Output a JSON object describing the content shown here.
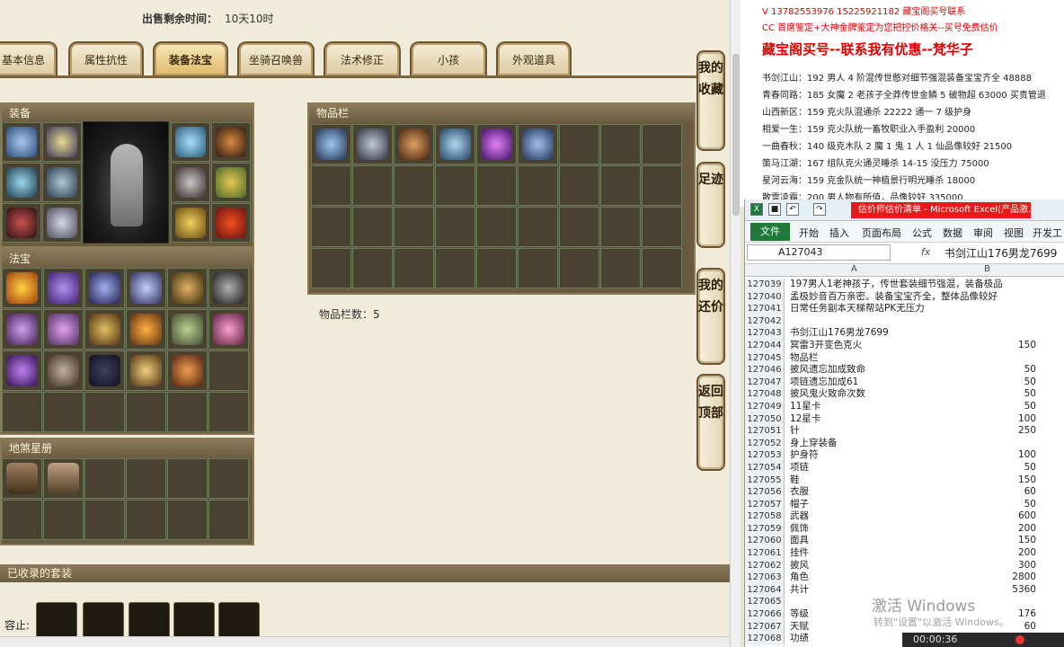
{
  "sale": {
    "label": "出售剩余时间：",
    "value": "10天10时"
  },
  "tabs": [
    "基本信息",
    "属性抗性",
    "装备法宝",
    "坐骑召唤兽",
    "法术修正",
    "小孩",
    "外观道具"
  ],
  "panels": {
    "equip": "装备",
    "fabao": "法宝",
    "star": "地煞星册",
    "items": "物品栏"
  },
  "item_count": "物品栏数：5",
  "sets_title": "已收录的套装",
  "sets_label": "容止:",
  "side_buttons": [
    "我的收藏",
    "足迹",
    "我的还价",
    "返回顶部"
  ],
  "doc": {
    "line1": "V 13782553976    15225921182   藏宝阁买号联系",
    "line2": "CC 首席鉴定+大神金牌鉴定为您把控价格关--买号免费估价",
    "line3": "藏宝阁买号--联系我有优惠--梵华子",
    "list": [
      "书剑江山：192 男人 4 阶混传世憨对细节强混装备宝宝齐全 48888",
      "青春同路：185 女魔 2 老孩子全莽传世金鳞 5 破物超 63000 买贵管退",
      "山西新区：159 克火队混通杀 22222 通一 7 级护身",
      "相爱一生：159 克火队统一畜牧职业入手盈利 20000",
      "一曲春秋：140 级克木队 2 魔 1 鬼 1 人 1 仙品像较好 21500",
      "策马江湖：167 组队克火通灵睡杀 14-15 没压力 75000",
      "星河云海：159 克金队统一神植景行明光睡杀 18000",
      "散雪凌霜：200 男人物有所值，品像较好 335000"
    ]
  },
  "excel": {
    "title": "估价师估价清单 - Microsoft Excel(产品激...",
    "ribbon": [
      "文件",
      "开始",
      "插入",
      "页面布局",
      "公式",
      "数据",
      "审阅",
      "视图",
      "开发工"
    ],
    "namebox": "A127043",
    "fx": "fx",
    "formula": "书剑江山176男龙7699",
    "col_a": "A",
    "col_b": "B",
    "rows": [
      {
        "n": "127039",
        "a": "197男人1老神孩子，传世套装细节强混，装备极品",
        "b": ""
      },
      {
        "n": "127040",
        "a": "孟极妙音百万亲密。装备宝宝齐全，整体品像较好",
        "b": ""
      },
      {
        "n": "127041",
        "a": "日常任务副本天梯帮站PK无压力",
        "b": ""
      },
      {
        "n": "127042",
        "a": "",
        "b": ""
      },
      {
        "n": "127043",
        "a": "书剑江山176男龙7699",
        "b": ""
      },
      {
        "n": "127044",
        "a": "冥雷3开变色克火",
        "b": "150"
      },
      {
        "n": "127045",
        "a": "物品栏",
        "b": ""
      },
      {
        "n": "127046",
        "a": "披风遗忘加成致命",
        "b": "50"
      },
      {
        "n": "127047",
        "a": "项链遗忘加成61",
        "b": "50"
      },
      {
        "n": "127048",
        "a": "披风鬼火致命次数",
        "b": "50"
      },
      {
        "n": "127049",
        "a": "11星卡",
        "b": "50"
      },
      {
        "n": "127050",
        "a": "12星卡",
        "b": "100"
      },
      {
        "n": "127051",
        "a": "针",
        "b": "250"
      },
      {
        "n": "127052",
        "a": "身上穿装备",
        "b": ""
      },
      {
        "n": "127053",
        "a": "护身符",
        "b": "100"
      },
      {
        "n": "127054",
        "a": "项链",
        "b": "50"
      },
      {
        "n": "127055",
        "a": "鞋",
        "b": "150"
      },
      {
        "n": "127056",
        "a": "衣服",
        "b": "60"
      },
      {
        "n": "127057",
        "a": "帽子",
        "b": "50"
      },
      {
        "n": "127058",
        "a": "武器",
        "b": "600"
      },
      {
        "n": "127059",
        "a": "佩饰",
        "b": "200"
      },
      {
        "n": "127060",
        "a": "面具",
        "b": "150"
      },
      {
        "n": "127061",
        "a": "挂件",
        "b": "200"
      },
      {
        "n": "127062",
        "a": "披风",
        "b": "300"
      },
      {
        "n": "127063",
        "a": "角色",
        "b": "2800"
      },
      {
        "n": "127064",
        "a": "共计",
        "b": "5360"
      },
      {
        "n": "127065",
        "a": "",
        "b": ""
      },
      {
        "n": "127066",
        "a": "等级",
        "b": "176"
      },
      {
        "n": "127067",
        "a": "天赋",
        "b": "60"
      },
      {
        "n": "127068",
        "a": "功绩",
        "b": ""
      }
    ]
  },
  "watermark": {
    "line1": "激活 Windows",
    "line2": "转到\"设置\"以激活 Windows。"
  },
  "player_time": "00:00:36",
  "colors": {
    "accent": "#d00000",
    "panel": "#6a5a40",
    "excel_green": "#1f7a3a",
    "title_red": "#e31b1b"
  }
}
